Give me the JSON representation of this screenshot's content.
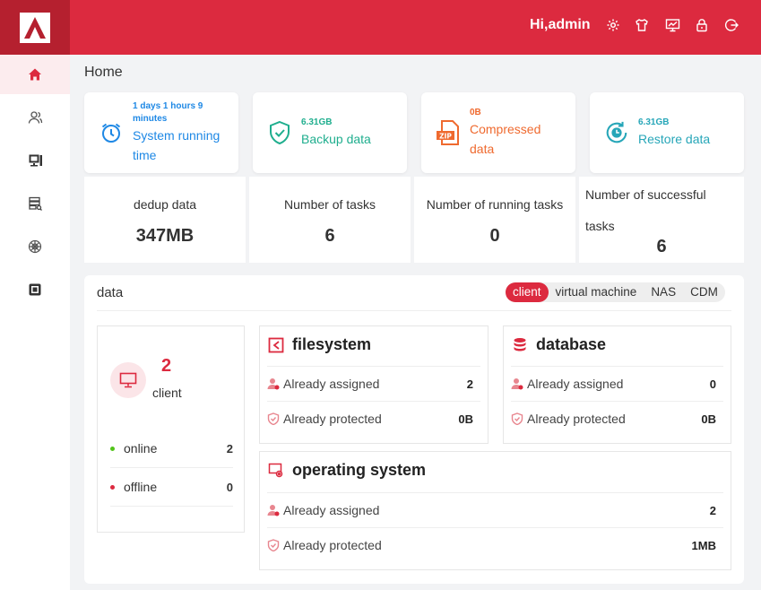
{
  "header": {
    "greeting": "Hi,admin",
    "icons": [
      "settings-icon",
      "theme-shirt-icon",
      "monitor-icon",
      "lock-icon",
      "logout-icon"
    ],
    "brand_color": "#dc2a3f"
  },
  "sidebar": {
    "items": [
      {
        "name": "home",
        "icon": "home-icon",
        "active": true
      },
      {
        "name": "users",
        "icon": "users-icon"
      },
      {
        "name": "clients",
        "icon": "monitor-icon"
      },
      {
        "name": "storage",
        "icon": "server-icon"
      },
      {
        "name": "network",
        "icon": "network-icon"
      },
      {
        "name": "device",
        "icon": "device-icon"
      }
    ]
  },
  "page": {
    "title": "Home"
  },
  "top_cards": [
    {
      "small": "1 days 1 hours 9 minutes",
      "label": "System running time",
      "color": "#1e88e5"
    },
    {
      "small": "6.31GB",
      "label": "Backup data",
      "color": "#1fae8e"
    },
    {
      "small": "0B",
      "label": "Compressed data",
      "color": "#ef6a2f"
    },
    {
      "small": "6.31GB",
      "label": "Restore data",
      "color": "#26a6b8"
    }
  ],
  "stats": [
    {
      "label": "dedup data",
      "value": "347MB"
    },
    {
      "label": "Number of tasks",
      "value": "6"
    },
    {
      "label": "Number of running tasks",
      "value": "0"
    },
    {
      "label": "Number of successful tasks",
      "value": "6"
    }
  ],
  "data_panel": {
    "title": "data",
    "tabs": [
      "client",
      "virtual machine",
      "NAS",
      "CDM"
    ],
    "active_tab": "client",
    "client": {
      "count": "2",
      "label": "client",
      "online_label": "online",
      "online_value": "2",
      "offline_label": "offline",
      "offline_value": "0",
      "online_color": "#52c41a",
      "offline_color": "#dc2a3f"
    },
    "filesystem": {
      "title": "filesystem",
      "assigned_label": "Already assigned",
      "assigned_value": "2",
      "protected_label": "Already protected",
      "protected_value": "0B"
    },
    "database": {
      "title": "database",
      "assigned_label": "Already assigned",
      "assigned_value": "0",
      "protected_label": "Already protected",
      "protected_value": "0B"
    },
    "os": {
      "title": "operating system",
      "assigned_label": "Already assigned",
      "assigned_value": "2",
      "protected_label": "Already protected",
      "protected_value": "1MB"
    }
  }
}
